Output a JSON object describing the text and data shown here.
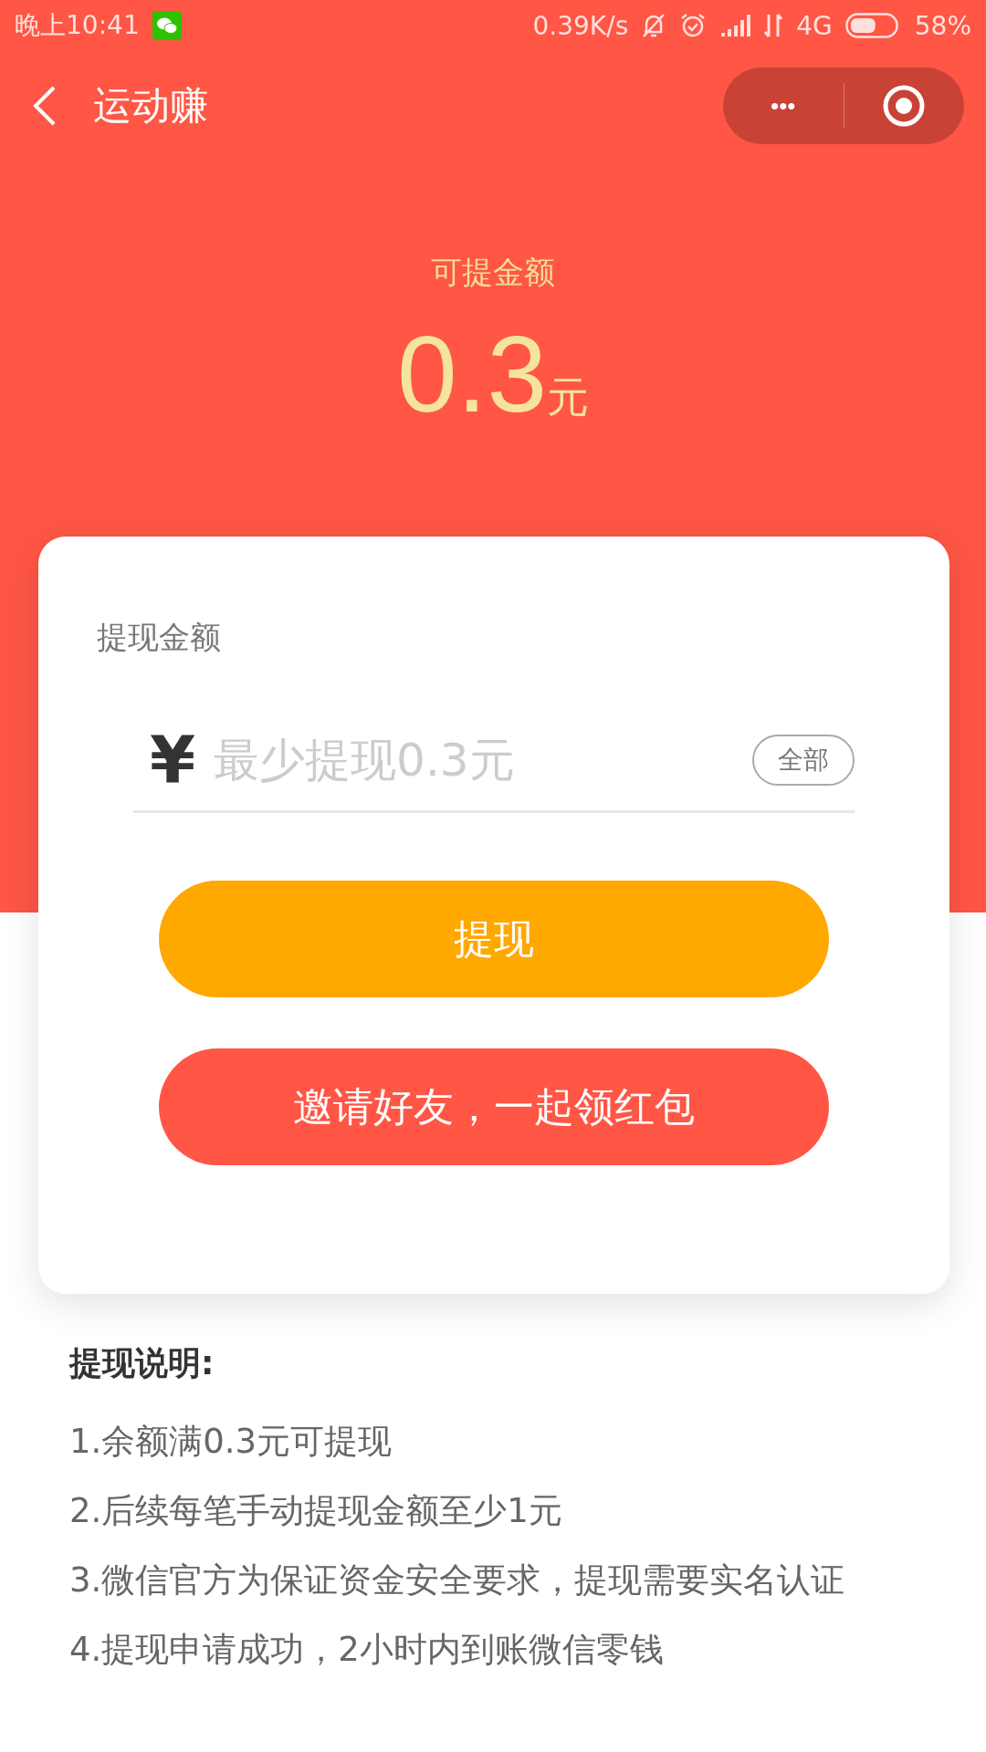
{
  "status_bar": {
    "time": "晚上10:41",
    "speed": "0.39K/s",
    "network": "4G",
    "battery": "58%"
  },
  "nav": {
    "title": "运动赚",
    "more": "•••"
  },
  "balance": {
    "label": "可提金额",
    "amount": "0.3",
    "unit": "元"
  },
  "card": {
    "label": "提现金额",
    "currency": "¥",
    "placeholder": "最少提现0.3元",
    "all_button": "全部",
    "buttons": [
      {
        "label": "提现",
        "kind": "primary"
      },
      {
        "label": "邀请好友，一起领红包",
        "kind": "invite"
      }
    ]
  },
  "notes": {
    "title": "提现说明:",
    "items": [
      "1.余额满0.3元可提现",
      "2.后续每笔手动提现金额至少1元",
      "3.微信官方为保证资金安全要求，提现需要实名认证",
      "4.提现申请成功，2小时内到账微信零钱"
    ]
  }
}
